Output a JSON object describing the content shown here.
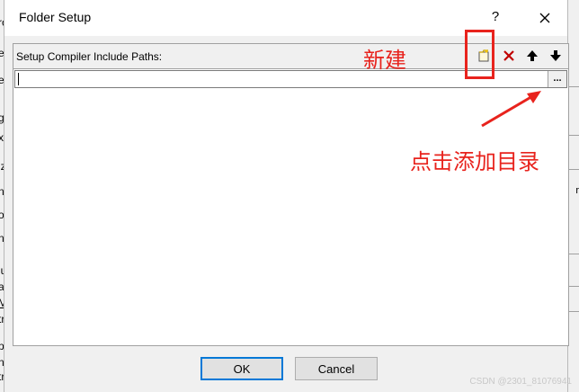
{
  "background_app": {
    "left_fragments": [
      "ro",
      "ef",
      "ef",
      "gu",
      "xe",
      "iz",
      "nk",
      "oli",
      "ne",
      "lu",
      "at",
      "M",
      "tri",
      "pp",
      "nt",
      "tri"
    ],
    "right_fragments": [
      "r"
    ]
  },
  "dialog": {
    "title": "Folder Setup",
    "help_label": "?",
    "close_label": "close"
  },
  "panel": {
    "label": "Setup Compiler Include Paths:",
    "toolbar": {
      "new_icon": "new-folder-icon",
      "delete_icon": "delete-x-icon",
      "move_up_icon": "arrow-up-icon",
      "move_down_icon": "arrow-down-icon"
    },
    "edit_value": "",
    "browse_label": "..."
  },
  "buttons": {
    "ok_label": "OK",
    "cancel_label": "Cancel"
  },
  "annotations": {
    "new_label": "新建",
    "browse_label": "点击添加目录",
    "color": "#e8231d"
  },
  "watermark": "CSDN @2301_81076941"
}
